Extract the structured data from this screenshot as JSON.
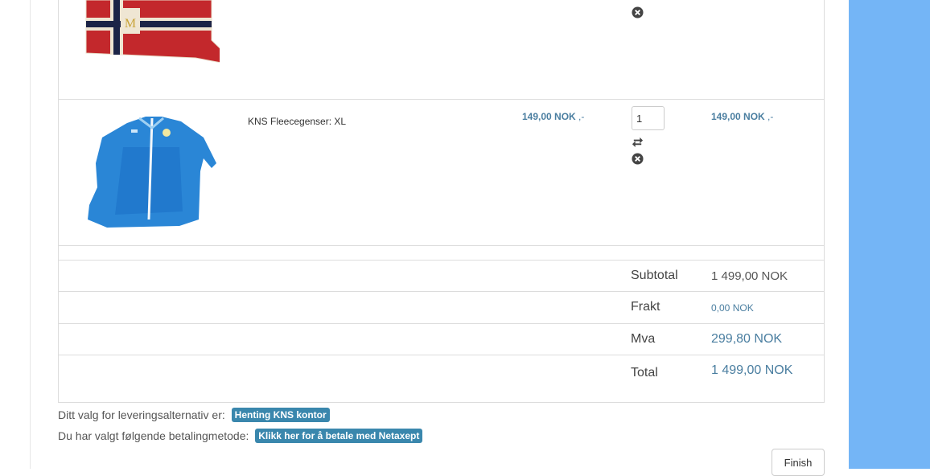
{
  "cart": {
    "items": [
      {
        "name": "",
        "image": "norwegian-pennant-flag",
        "price": "",
        "price_suffix": "",
        "quantity": "",
        "total": "",
        "total_suffix": ""
      },
      {
        "name": "KNS Fleecegenser: XL",
        "image": "blue-fleece-jacket",
        "price": "149,00 NOK",
        "price_suffix": ",-",
        "quantity": "1",
        "total": "149,00 NOK",
        "total_suffix": ",-"
      }
    ]
  },
  "summary": {
    "subtotal_label": "Subtotal",
    "subtotal_value": "1 499,00 NOK",
    "shipping_label": "Frakt",
    "shipping_value": "0,00 NOK",
    "vat_label": "Mva",
    "vat_value": "299,80 NOK",
    "total_label": "Total",
    "total_value": "1 499,00 NOK"
  },
  "delivery": {
    "label": "Ditt valg for leveringsalternativ er:",
    "choice": "Henting KNS kontor"
  },
  "payment": {
    "label": "Du har valgt følgende betalingmetode:",
    "choice": "Klikk her for å betale med Netaxept"
  },
  "actions": {
    "finish_label": "Finish"
  },
  "colors": {
    "accent": "#3a87ad",
    "price": "#4a7ea0",
    "side_panel": "#74b5f6"
  },
  "icons": {
    "update": "refresh-arrows-icon",
    "remove": "remove-circle-icon"
  }
}
